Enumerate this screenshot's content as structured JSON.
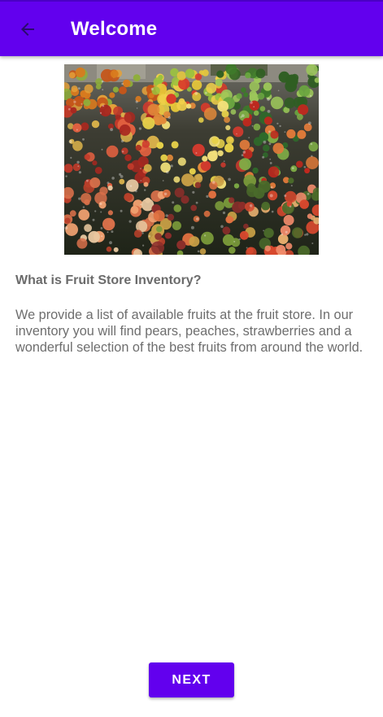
{
  "app_bar": {
    "title": "Welcome",
    "back_icon": "arrow-back-icon",
    "background": "#6200EE"
  },
  "hero_image": {
    "subject": "fruit-market-stall-photo"
  },
  "content": {
    "question": "What is Fruit Store Inventory?",
    "description": "We provide a list of available fruits at the fruit store. In our inventory you will find pears, peaches, strawberries and a wonderful selection of the best fruits from around the world."
  },
  "footer": {
    "next_label": "NEXT",
    "accent": "#6200EE"
  }
}
